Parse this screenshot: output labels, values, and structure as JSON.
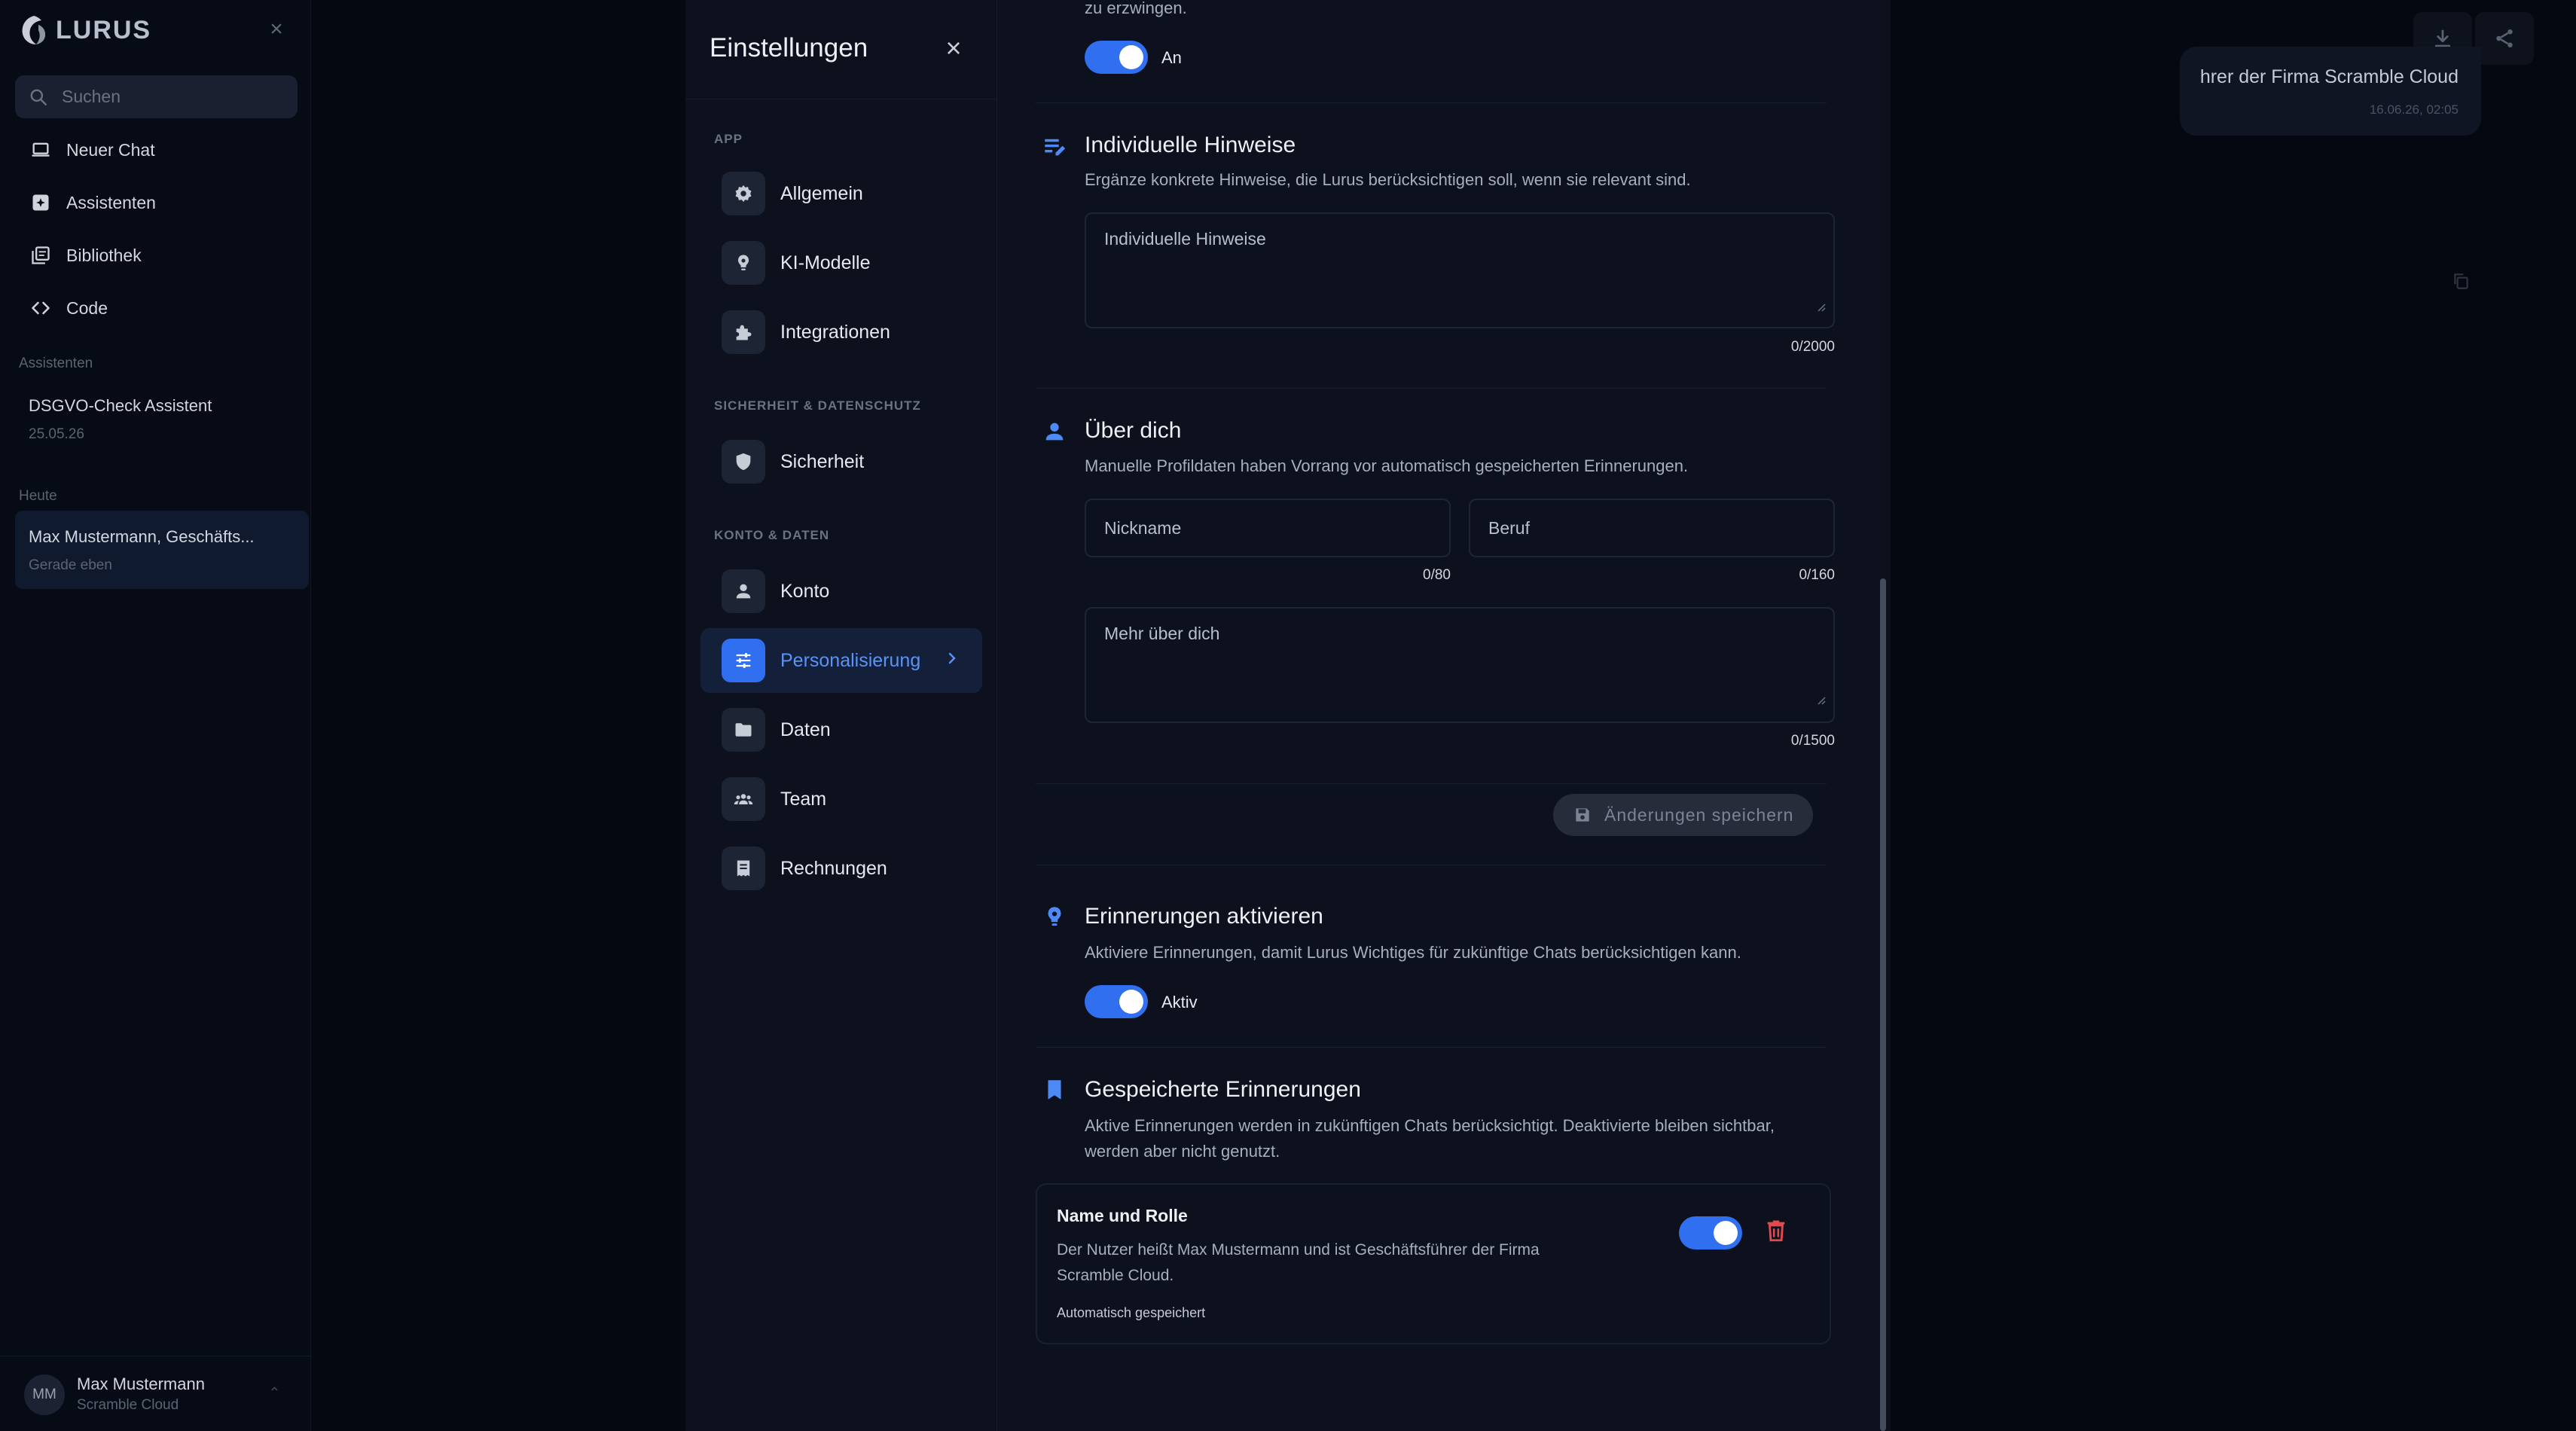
{
  "sidebar": {
    "logo_text": "LURUS",
    "search_placeholder": "Suchen",
    "nav": [
      {
        "label": "Neuer Chat",
        "icon": "laptop-icon"
      },
      {
        "label": "Assistenten",
        "icon": "assistant-icon"
      },
      {
        "label": "Bibliothek",
        "icon": "library-icon"
      },
      {
        "label": "Code",
        "icon": "code-icon"
      }
    ],
    "assistants_heading": "Assistenten",
    "assistants": [
      {
        "title": "DSGVO-Check Assistent",
        "date": "25.05.26"
      }
    ],
    "today_heading": "Heute",
    "today": [
      {
        "title": "Max Mustermann, Geschäfts...",
        "date": "Gerade eben"
      }
    ],
    "user": {
      "initials": "MM",
      "name": "Max Mustermann",
      "org": "Scramble Cloud"
    }
  },
  "chat": {
    "message_text": "hrer der Firma Scramble Cloud",
    "message_time": "16.06.26, 02:05"
  },
  "settings": {
    "title": "Einstellungen",
    "groups": [
      {
        "label": "APP",
        "items": [
          "Allgemein",
          "KI-Modelle",
          "Integrationen"
        ]
      },
      {
        "label": "SICHERHEIT & DATENSCHUTZ",
        "items": [
          "Sicherheit"
        ]
      },
      {
        "label": "KONTO & DATEN",
        "items": [
          "Konto",
          "Personalisierung",
          "Daten",
          "Team",
          "Rechnungen"
        ]
      }
    ],
    "active_item": "Personalisierung",
    "accent_color": "#2f6ff0",
    "top_fragment": "zu erzwingen.",
    "top_toggle_label": "An",
    "hints": {
      "title": "Individuelle Hinweise",
      "desc": "Ergänze konkrete Hinweise, die Lurus berücksichtigen soll, wenn sie relevant sind.",
      "placeholder": "Individuelle Hinweise",
      "counter": "0/2000"
    },
    "about": {
      "title": "Über dich",
      "desc": "Manuelle Profildaten haben Vorrang vor automatisch gespeicherten Erinnerungen.",
      "nickname_placeholder": "Nickname",
      "nickname_counter": "0/80",
      "job_placeholder": "Beruf",
      "job_counter": "0/160",
      "more_placeholder": "Mehr über dich",
      "more_counter": "0/1500"
    },
    "save_label": "Änderungen speichern",
    "memories": {
      "title": "Erinnerungen aktivieren",
      "desc": "Aktiviere Erinnerungen, damit Lurus Wichtiges für zukünftige Chats berücksichtigen kann.",
      "toggle_label": "Aktiv"
    },
    "saved": {
      "title": "Gespeicherte Erinnerungen",
      "desc_line1": "Aktive Erinnerungen werden in zukünftigen Chats berücksichtigt. Deaktivierte bleiben sichtbar,",
      "desc_line2": "werden aber nicht genutzt.",
      "items": [
        {
          "title": "Name und Rolle",
          "text_line1": "Der Nutzer heißt Max Mustermann und ist Geschäftsführer der Firma",
          "text_line2": "Scramble Cloud.",
          "meta": "Automatisch gespeichert"
        }
      ]
    }
  }
}
